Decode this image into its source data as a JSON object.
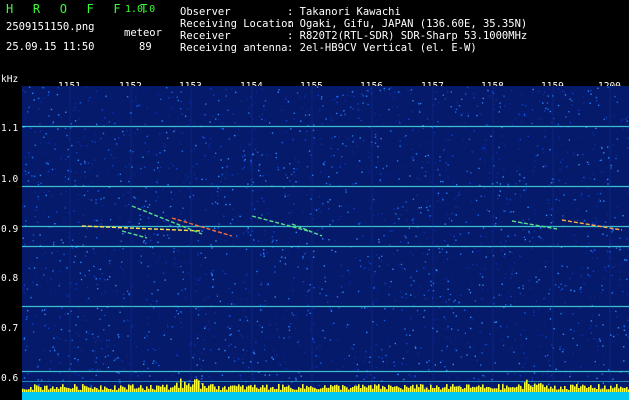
{
  "app": {
    "title": "H R O F F T",
    "version": "1.0.0",
    "filename": "2509151150.png",
    "datetime": "25.09.15 11:50",
    "mode_label": "meteor",
    "count": "89"
  },
  "info": {
    "rows": [
      {
        "label": "Observer",
        "value": ": Takanori Kawachi"
      },
      {
        "label": "Receiving Location",
        "value": ": Ogaki, Gifu, JAPAN (136.60E, 35.35N)"
      },
      {
        "label": "Receiver",
        "value": ": R820T2(RTL-SDR) SDR-Sharp 53.1000MHz"
      },
      {
        "label": "Receiving antenna",
        "value": ": 2el-HB9CV Vertical (el. E-W)"
      }
    ]
  },
  "axes": {
    "y_unit": "kHz",
    "x_ticks": [
      "1151",
      "1152",
      "1153",
      "1154",
      "1155",
      "1156",
      "1157",
      "1158",
      "1159",
      "1200"
    ],
    "y_ticks": [
      "1.1",
      "1.0",
      "0.9",
      "0.8",
      "0.7",
      "0.6"
    ]
  },
  "spectrogram": {
    "horizontal_lines_khz": [
      1.105,
      0.985,
      0.905,
      0.865,
      0.745,
      0.615
    ]
  }
}
